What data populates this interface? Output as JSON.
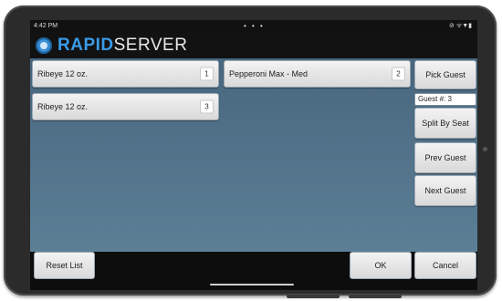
{
  "status_bar": {
    "time": "4:42 PM",
    "dots": "• • •",
    "icons": "⊘ ᯤ▼▮"
  },
  "logo": {
    "rapid": "RAPID",
    "server": "SERVER"
  },
  "order_items": [
    {
      "name": "Ribeye 12 oz.",
      "qty": "1"
    },
    {
      "name": "Pepperoni Max - Med",
      "qty": "2"
    },
    {
      "name": "Ribeye 12 oz.",
      "qty": "3"
    }
  ],
  "side_panel": {
    "pick_guest": "Pick Guest",
    "guest_field": "Guest #: 3",
    "split_by_seat": "Split By Seat",
    "prev_guest": "Prev Guest",
    "next_guest": "Next Guest"
  },
  "footer": {
    "reset_list": "Reset List",
    "ok": "OK",
    "cancel": "Cancel"
  },
  "colors": {
    "background": "#5a7c93",
    "accent": "#3a9be8"
  }
}
